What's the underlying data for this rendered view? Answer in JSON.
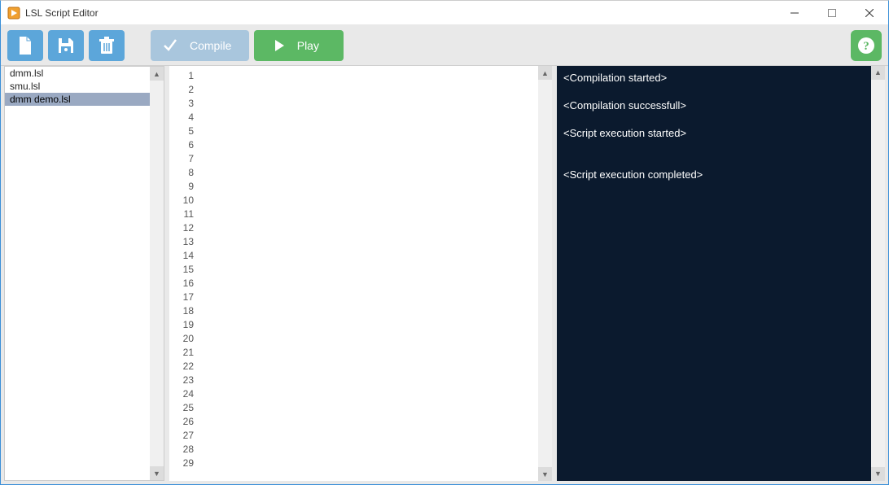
{
  "window": {
    "title": "LSL Script Editor"
  },
  "toolbar": {
    "new_label": "",
    "save_label": "",
    "delete_label": "",
    "compile_label": "Compile",
    "play_label": "Play",
    "help_label": ""
  },
  "files": {
    "items": [
      {
        "name": "dmm.lsl",
        "selected": false
      },
      {
        "name": "smu.lsl",
        "selected": false
      },
      {
        "name": "dmm demo.lsl",
        "selected": true
      }
    ]
  },
  "editor": {
    "line_start": 1,
    "line_end": 29,
    "content": ""
  },
  "output": {
    "messages": [
      "<Compilation started>",
      "<Compilation successfull>",
      "<Script execution started>",
      "",
      "<Script execution completed>"
    ]
  }
}
